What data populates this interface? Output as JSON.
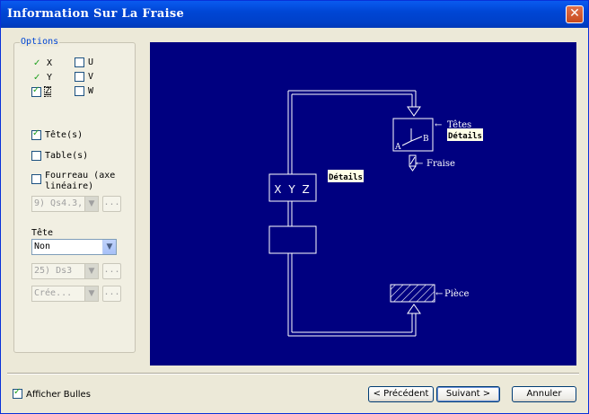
{
  "window": {
    "title": "Information Sur La Fraise",
    "close_glyph": "✕"
  },
  "options": {
    "legend": "Options",
    "axes_left": [
      {
        "label": "X",
        "state": "checkmark"
      },
      {
        "label": "Y",
        "state": "checkmark"
      },
      {
        "label": "Z",
        "state": "checked"
      }
    ],
    "axes_right": [
      {
        "label": "U",
        "state": "unchecked"
      },
      {
        "label": "V",
        "state": "unchecked"
      },
      {
        "label": "W",
        "state": "unchecked"
      }
    ],
    "tetes": {
      "label": "Tête(s)",
      "checked": true
    },
    "tables": {
      "label": "Table(s)",
      "checked": false
    },
    "fourreau": {
      "label_line1": "Fourreau (axe",
      "label_line2": "linéaire)",
      "checked": false
    },
    "fourreau_select": "9) Qs4.3,",
    "tete_label": "Tête",
    "tete_select": "Non",
    "head_select": "25) Ds3",
    "create_select": "Crée...",
    "dots": "..."
  },
  "diagram": {
    "xyz_label": "X Y Z",
    "details_1": "Détails",
    "details_2": "Détails",
    "tetes_label": "Têtes",
    "fraise_label": "Fraise",
    "piece_label": "Pièce",
    "axis_a": "A",
    "axis_b": "B",
    "arrow_left": "←"
  },
  "footer": {
    "afficher_bulles": "Afficher Bulles",
    "precedent": "< Précédent",
    "suivant": "Suivant >",
    "annuler": "Annuler"
  }
}
